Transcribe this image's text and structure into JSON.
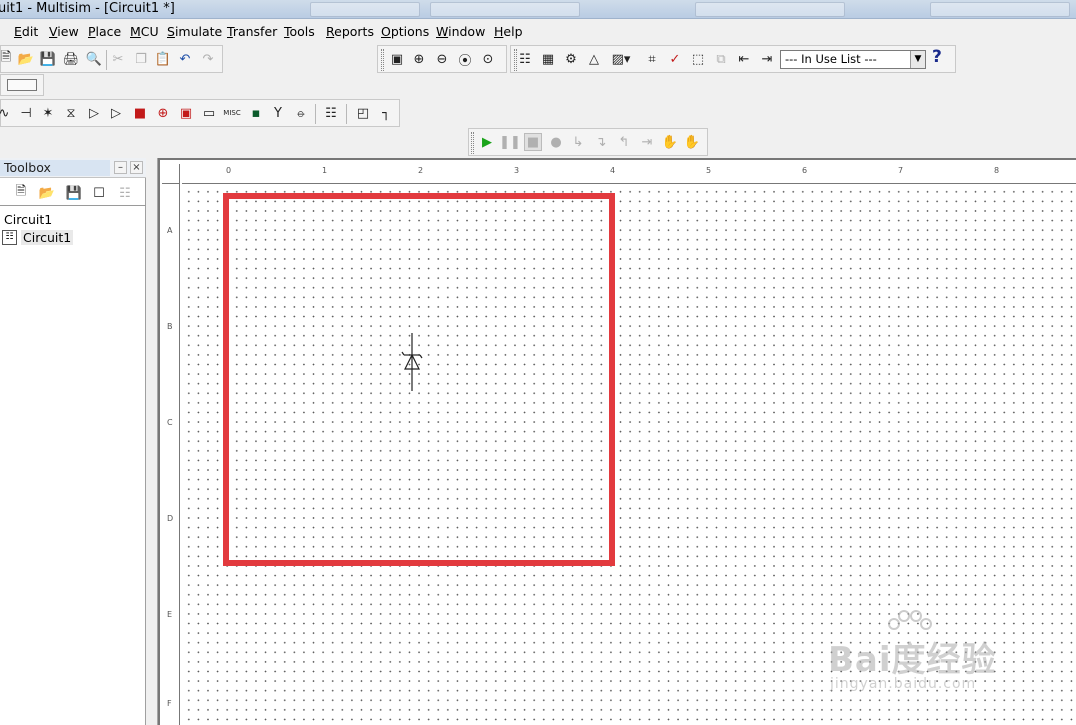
{
  "window": {
    "title": "uit1 - Multisim - [Circuit1 *]"
  },
  "menu": [
    "Edit",
    "View",
    "Place",
    "MCU",
    "Simulate",
    "Transfer",
    "Tools",
    "Reports",
    "Options",
    "Window",
    "Help"
  ],
  "toolbar": {
    "in_use_list": "--- In Use List ---",
    "help_glyph": "?"
  },
  "toolbox": {
    "title": "Toolbox",
    "pin_glyph": "–",
    "close_glyph": "×",
    "tree_root": "Circuit1",
    "tree_child": "Circuit1"
  },
  "ruler": {
    "top_numbers": [
      "0",
      "1",
      "2",
      "3",
      "4",
      "5",
      "6",
      "7",
      "8"
    ],
    "left_letters": [
      "A",
      "B",
      "C",
      "D",
      "E",
      "F"
    ]
  },
  "watermark": {
    "main": "Bai度经验",
    "sub": "jingyan.baidu.com"
  },
  "colors": {
    "highlight": "#e23a3e",
    "sim_run": "#1aa31a"
  }
}
